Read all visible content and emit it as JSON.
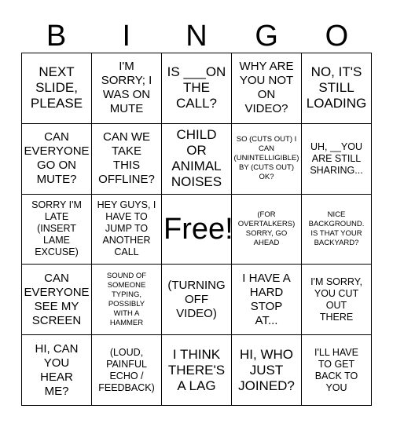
{
  "card": {
    "title": "BINGO",
    "header_letters": [
      "B",
      "I",
      "N",
      "G",
      "O"
    ],
    "free_space_label": "Free!",
    "colors": {
      "background": "#ffffff",
      "text": "#000000",
      "border": "#000000"
    },
    "grid_size": "5x5",
    "rows": [
      {
        "cells": [
          {
            "text": "NEXT\nSLIDE,\nPLEASE",
            "size": "lg"
          },
          {
            "text": "I'M\nSORRY; I\nWAS ON\nMUTE",
            "size": "md"
          },
          {
            "text": "IS ___ON\nTHE\nCALL?",
            "size": "lg"
          },
          {
            "text": "WHY ARE\nYOU NOT\nON\nVIDEO?",
            "size": "md"
          },
          {
            "text": "NO, IT'S\nSTILL\nLOADING",
            "size": "lg"
          }
        ]
      },
      {
        "cells": [
          {
            "text": "CAN\nEVERYONE\nGO ON\nMUTE?",
            "size": "md"
          },
          {
            "text": "CAN WE\nTAKE\nTHIS\nOFFLINE?",
            "size": "md"
          },
          {
            "text": "CHILD\nOR\nANIMAL\nNOISES",
            "size": "lg"
          },
          {
            "text": "SO (CUTS OUT) I\nCAN\n(UNINTELLIGIBLE)\nBY (CUTS OUT)\nOK?",
            "size": "xs"
          },
          {
            "text": "UH, __YOU\nARE STILL\nSHARING...",
            "size": "sm"
          }
        ]
      },
      {
        "cells": [
          {
            "text": "SORRY I'M\nLATE\n(INSERT\nLAME\nEXCUSE)",
            "size": "sm"
          },
          {
            "text": "HEY GUYS, I\nHAVE TO\nJUMP TO\nANOTHER\nCALL",
            "size": "sm"
          },
          {
            "text": "Free!",
            "size": "free"
          },
          {
            "text": "(FOR\nOVERTALKERS)\nSORRY, GO\nAHEAD",
            "size": "xs"
          },
          {
            "text": "NICE\nBACKGROUND.\nIS THAT YOUR\nBACKYARD?",
            "size": "xs"
          }
        ]
      },
      {
        "cells": [
          {
            "text": "CAN\nEVERYONE\nSEE MY\nSCREEN",
            "size": "md"
          },
          {
            "text": "SOUND OF\nSOMEONE\nTYPING,\nPOSSIBLY\nWITH A\nHAMMER",
            "size": "xs"
          },
          {
            "text": "(TURNING\nOFF\nVIDEO)",
            "size": "md"
          },
          {
            "text": "I HAVE A\nHARD\nSTOP\nAT...",
            "size": "md"
          },
          {
            "text": "I'M SORRY,\nYOU CUT\nOUT\nTHERE",
            "size": "sm"
          }
        ]
      },
      {
        "cells": [
          {
            "text": "HI, CAN\nYOU\nHEAR\nME?",
            "size": "md"
          },
          {
            "text": "(LOUD,\nPAINFUL\nECHO /\nFEEDBACK)",
            "size": "sm"
          },
          {
            "text": "I THINK\nTHERE'S\nA LAG",
            "size": "lg"
          },
          {
            "text": "HI, WHO\nJUST\nJOINED?",
            "size": "lg"
          },
          {
            "text": "I'LL HAVE\nTO GET\nBACK TO\nYOU",
            "size": "sm"
          }
        ]
      }
    ]
  }
}
